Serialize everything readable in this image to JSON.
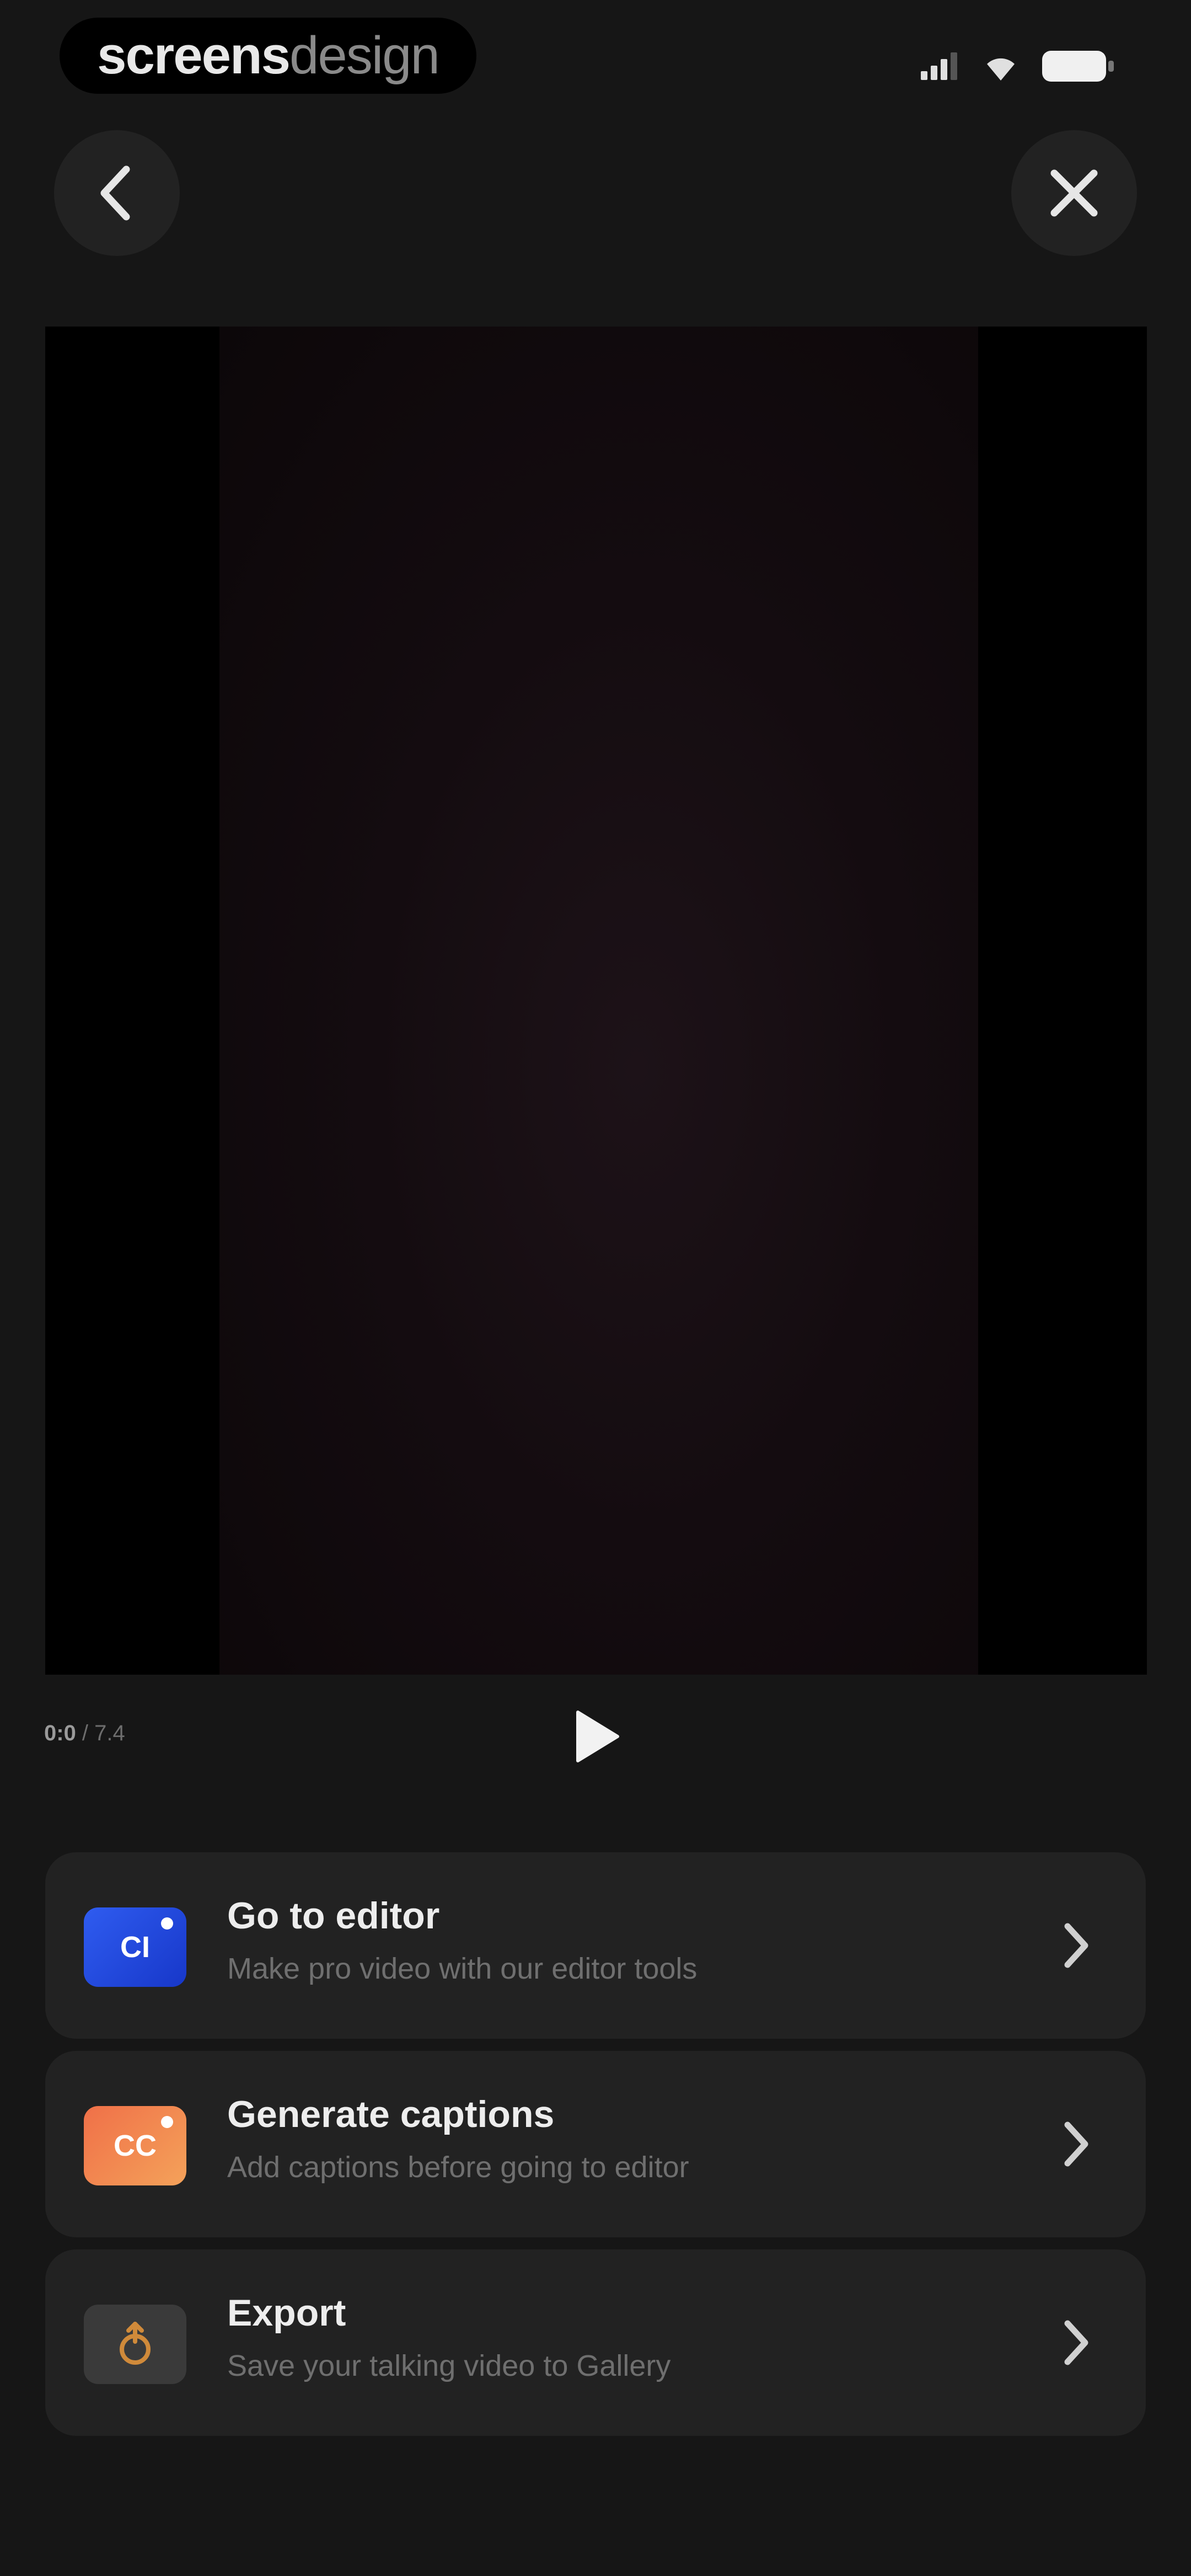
{
  "status_bar": {
    "brand_bold": "screens",
    "brand_light": "design"
  },
  "nav": {
    "back_icon": "chevron-left-icon",
    "close_icon": "close-icon"
  },
  "player": {
    "current_time": "0:0",
    "separator": " / ",
    "duration": "7.4"
  },
  "actions": [
    {
      "title": "Go to editor",
      "subtitle": "Make pro video with our editor tools",
      "icon_label": "CI",
      "icon": "editor-icon",
      "color": "#2448e0"
    },
    {
      "title": "Generate captions",
      "subtitle": "Add captions before going to editor",
      "icon_label": "CC",
      "icon": "captions-icon",
      "color": "#f08050"
    },
    {
      "title": "Export",
      "subtitle": "Save your talking video to Gallery",
      "icon": "export-icon",
      "color": "#3a3a3a"
    }
  ]
}
